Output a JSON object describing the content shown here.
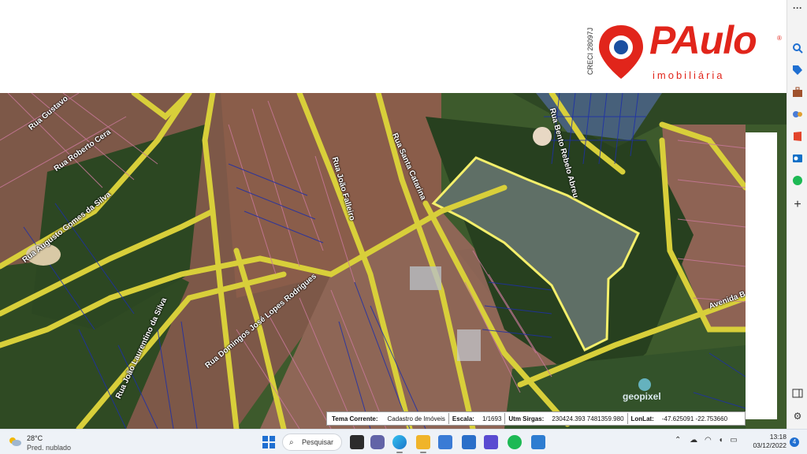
{
  "header": {
    "creci": "CRECI 28097J",
    "logo_word": "PAulo",
    "logo_reg": "®",
    "logo_sub": "imobiliária"
  },
  "map": {
    "street_labels": [
      "Rua Gustavo",
      "Rua Roberto Cera",
      "Rua Augusto Gomes da Silva",
      "Rua João Falleiro",
      "Rua Santa Catarina",
      "Rua Bento Rebelo Abreu",
      "Rua Domingos José Lopes Rodrigues",
      "Rua João Laurentino da Silva",
      "Avenida B"
    ],
    "geo_logo": "geopixel"
  },
  "info_bar": {
    "tema_label": "Tema Corrente:",
    "tema_value": "Cadastro de Imóveis",
    "escala_label": "Escala:",
    "escala_value": "1/1693",
    "utm_label": "Utm Sirgas:",
    "utm_value": "230424.393 7481359.980",
    "lonlat_label": "LonLat:",
    "lonlat_value": "-47.625091 -22.753660"
  },
  "sidebar": {
    "icons": [
      "more-icon",
      "search-icon",
      "tag-icon",
      "briefcase-icon",
      "games-icon",
      "office-icon",
      "outlook-icon",
      "spotify-icon",
      "add-icon",
      "collapse-icon",
      "settings-icon"
    ]
  },
  "taskbar": {
    "temperature": "28°C",
    "weather_desc": "Pred. nublado",
    "search_label": "Pesquisar",
    "time": "13:18",
    "date": "03/12/2022",
    "notifications": "4"
  },
  "colors": {
    "brand_red": "#e1251b",
    "road_yellow": "#d8cf3a",
    "highlight_yellow": "#f4ef6b",
    "parcel_blue": "#1d2fa8"
  }
}
